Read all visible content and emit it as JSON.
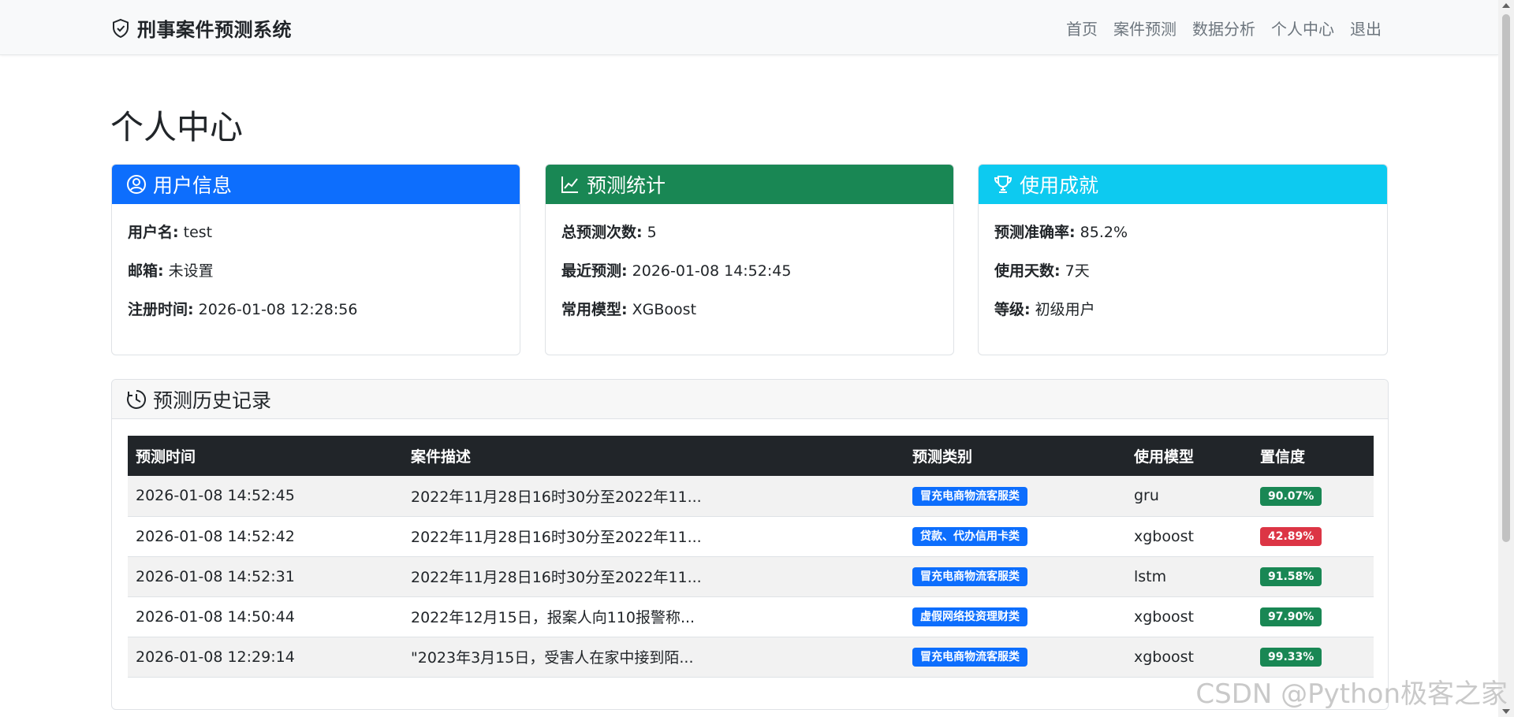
{
  "navbar": {
    "brand": "刑事案件预测系统",
    "links": [
      "首页",
      "案件预测",
      "数据分析",
      "个人中心",
      "退出"
    ]
  },
  "page": {
    "title": "个人中心"
  },
  "user_info": {
    "header": "用户信息",
    "rows": [
      {
        "label": "用户名:",
        "value": " test"
      },
      {
        "label": "邮箱:",
        "value": " 未设置"
      },
      {
        "label": "注册时间:",
        "value": " 2026-01-08 12:28:56"
      }
    ]
  },
  "stats": {
    "header": "预测统计",
    "rows": [
      {
        "label": "总预测次数:",
        "value": " 5"
      },
      {
        "label": "最近预测:",
        "value": " 2026-01-08 14:52:45"
      },
      {
        "label": "常用模型:",
        "value": " XGBoost"
      }
    ]
  },
  "achievements": {
    "header": "使用成就",
    "rows": [
      {
        "label": "预测准确率:",
        "value": " 85.2%"
      },
      {
        "label": "使用天数:",
        "value": " 7天"
      },
      {
        "label": "等级:",
        "value": " 初级用户"
      }
    ]
  },
  "history": {
    "header": "预测历史记录",
    "columns": [
      "预测时间",
      "案件描述",
      "预测类别",
      "使用模型",
      "置信度"
    ],
    "rows": [
      {
        "time": "2026-01-08 14:52:45",
        "desc": "2022年11月28日16时30分至2022年11...",
        "category": "冒充电商物流客服类",
        "model": "gru",
        "confidence": "90.07%",
        "conf_type": "success"
      },
      {
        "time": "2026-01-08 14:52:42",
        "desc": "2022年11月28日16时30分至2022年11...",
        "category": "贷款、代办信用卡类",
        "model": "xgboost",
        "confidence": "42.89%",
        "conf_type": "danger"
      },
      {
        "time": "2026-01-08 14:52:31",
        "desc": "2022年11月28日16时30分至2022年11...",
        "category": "冒充电商物流客服类",
        "model": "lstm",
        "confidence": "91.58%",
        "conf_type": "success"
      },
      {
        "time": "2026-01-08 14:50:44",
        "desc": "2022年12月15日，报案人向110报警称...",
        "category": "虚假网络投资理财类",
        "model": "xgboost",
        "confidence": "97.90%",
        "conf_type": "success"
      },
      {
        "time": "2026-01-08 12:29:14",
        "desc": "\"2023年3月15日，受害人在家中接到陌...",
        "category": "冒充电商物流客服类",
        "model": "xgboost",
        "confidence": "99.33%",
        "conf_type": "success"
      }
    ]
  },
  "watermark": "CSDN @Python极客之家",
  "colors": {
    "primary": "#0d6efd",
    "success": "#198754",
    "info": "#0dcaf0",
    "danger": "#dc3545",
    "dark": "#212529"
  },
  "icons": {
    "brand": "shield-icon",
    "user": "user-circle-icon",
    "stats": "line-chart-icon",
    "achievements": "trophy-icon",
    "history": "clock-history-icon"
  }
}
